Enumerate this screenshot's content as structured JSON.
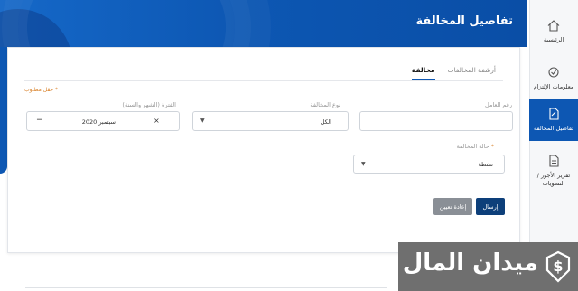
{
  "header": {
    "title": "تفاصيل المخالفة"
  },
  "sidebar": {
    "items": [
      {
        "label": "الرئيسية",
        "icon": "home-icon",
        "active": false
      },
      {
        "label": "معلومات الإلتزام",
        "icon": "commitment-icon",
        "active": false
      },
      {
        "label": "تفاصيل المخالفة",
        "icon": "violation-details-icon",
        "active": true
      },
      {
        "label": "تقرير الأجور / التسويات",
        "icon": "wages-report-icon",
        "active": false
      }
    ]
  },
  "tabs": [
    {
      "label": "مخالفة",
      "active": true
    },
    {
      "label": "أرشفة المخالفات",
      "active": false
    }
  ],
  "form": {
    "required_note": "حقل مطلوب",
    "worker_id": {
      "label": "رقم العامل",
      "value": ""
    },
    "violation_type": {
      "label": "نوع المخالفة",
      "value": "الكل"
    },
    "period": {
      "label": "الفترة (الشهر والسنة)",
      "value": "سبتمبر 2020"
    },
    "violation_status": {
      "label": "حالة المخالفة",
      "value": "نشطة"
    }
  },
  "buttons": {
    "submit": "إرسال",
    "reset": "إعادة تعيين"
  },
  "watermark": {
    "text": "ميدان المال"
  },
  "colors": {
    "primary": "#0d57b3",
    "submit": "#0d3f7a",
    "reset": "#8a8f96",
    "required": "#d9822b"
  }
}
